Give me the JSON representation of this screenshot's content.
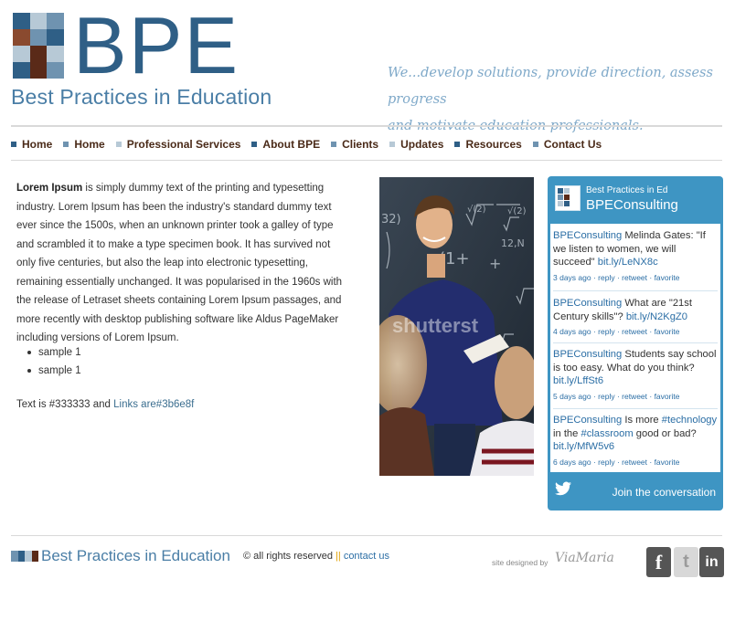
{
  "header": {
    "logo_text": "BPE",
    "logo_subtitle": "Best Practices in Education",
    "tagline_line1": "We...develop solutions, provide direction, assess progress",
    "tagline_line2": "and motivate education professionals.",
    "mosaic_colors": [
      "#2f5f86",
      "#b7c9d6",
      "#6f93b0",
      "#8a4a2f",
      "#6f93b0",
      "#2f5f86",
      "#b7c9d6",
      "#5a2a18",
      "#b7c9d6",
      "#2f5f86",
      "#5a2a18",
      "#6f93b0"
    ]
  },
  "nav": {
    "items": [
      {
        "label": "Home",
        "bullet_color": "#2f5f86"
      },
      {
        "label": "Home",
        "bullet_color": "#6f93b0"
      },
      {
        "label": "Professional Services",
        "bullet_color": "#b7c9d6"
      },
      {
        "label": "About BPE",
        "bullet_color": "#2f5f86"
      },
      {
        "label": "Clients",
        "bullet_color": "#6f93b0"
      },
      {
        "label": "Updates",
        "bullet_color": "#b7c9d6"
      },
      {
        "label": "Resources",
        "bullet_color": "#2f5f86"
      },
      {
        "label": "Contact Us",
        "bullet_color": "#6f93b0"
      }
    ]
  },
  "main": {
    "lead_bold": "Lorem Ipsum",
    "body": " is simply dummy text of the printing and typesetting industry. Lorem Ipsum has been the industry's standard dummy text ever since the 1500s, when an unknown printer took a galley of type and scrambled it to make a type specimen book. It has survived not only five centuries, but also the leap into electronic typesetting, remaining essentially unchanged. It was popularised in the 1960s with the release of Letraset sheets containing Lorem Ipsum passages, and more recently with desktop publishing software like Aldus PageMaker including versions of Lorem Ipsum.",
    "list": [
      "sample 1",
      "sample 1"
    ],
    "color_note_text": "Text is #333333 and ",
    "color_note_link": "Links are#3b6e8f"
  },
  "photo": {
    "watermark": "shutterst",
    "board_text": [
      "32)",
      "√(2)",
      "(1+",
      "12,N",
      "√(2)",
      "+"
    ]
  },
  "twitter": {
    "name": "Best Practices in Ed",
    "handle": "BPEConsulting",
    "tweets": [
      {
        "user": "BPEConsulting",
        "text": " Melinda Gates: \"If we listen to women, we will succeed\" ",
        "link": "bit.ly/LeNX8c",
        "time": "3 days ago",
        "actions": "· reply · retweet · favorite"
      },
      {
        "user": "BPEConsulting",
        "text": " What are \"21st Century skills\"? ",
        "link": "bit.ly/N2KgZ0",
        "time": "4 days ago",
        "actions": "· reply · retweet · favorite"
      },
      {
        "user": "BPEConsulting",
        "text": " Students say school is too easy. What do you think? ",
        "link": "bit.ly/LffSt6",
        "time": "5 days ago",
        "actions": "· reply · retweet · favorite"
      },
      {
        "user": "BPEConsulting",
        "text": " Is more ",
        "hashtag1": "#technology",
        "text2": " in the ",
        "hashtag2": "#classroom",
        "text3": " good or bad? ",
        "link": "bit.ly/MfW5v6",
        "time": "6 days ago",
        "actions": "· reply · retweet · favorite"
      }
    ],
    "join_label": "Join the conversation"
  },
  "footer": {
    "logo_text": "Best Practices in Education",
    "rights": "© all rights reserved ",
    "separator": "||",
    "contact_link": "contact us",
    "designed_by": "site designed by",
    "designer": "ViaMaria",
    "social": {
      "facebook": "f",
      "twitter": "t",
      "linkedin": "in"
    }
  },
  "colors": {
    "brand_dark": "#2f5f86",
    "brand_light": "#4a7ea6",
    "twitter_blue": "#3e95c3",
    "link": "#3b6e8f",
    "text": "#333333"
  }
}
